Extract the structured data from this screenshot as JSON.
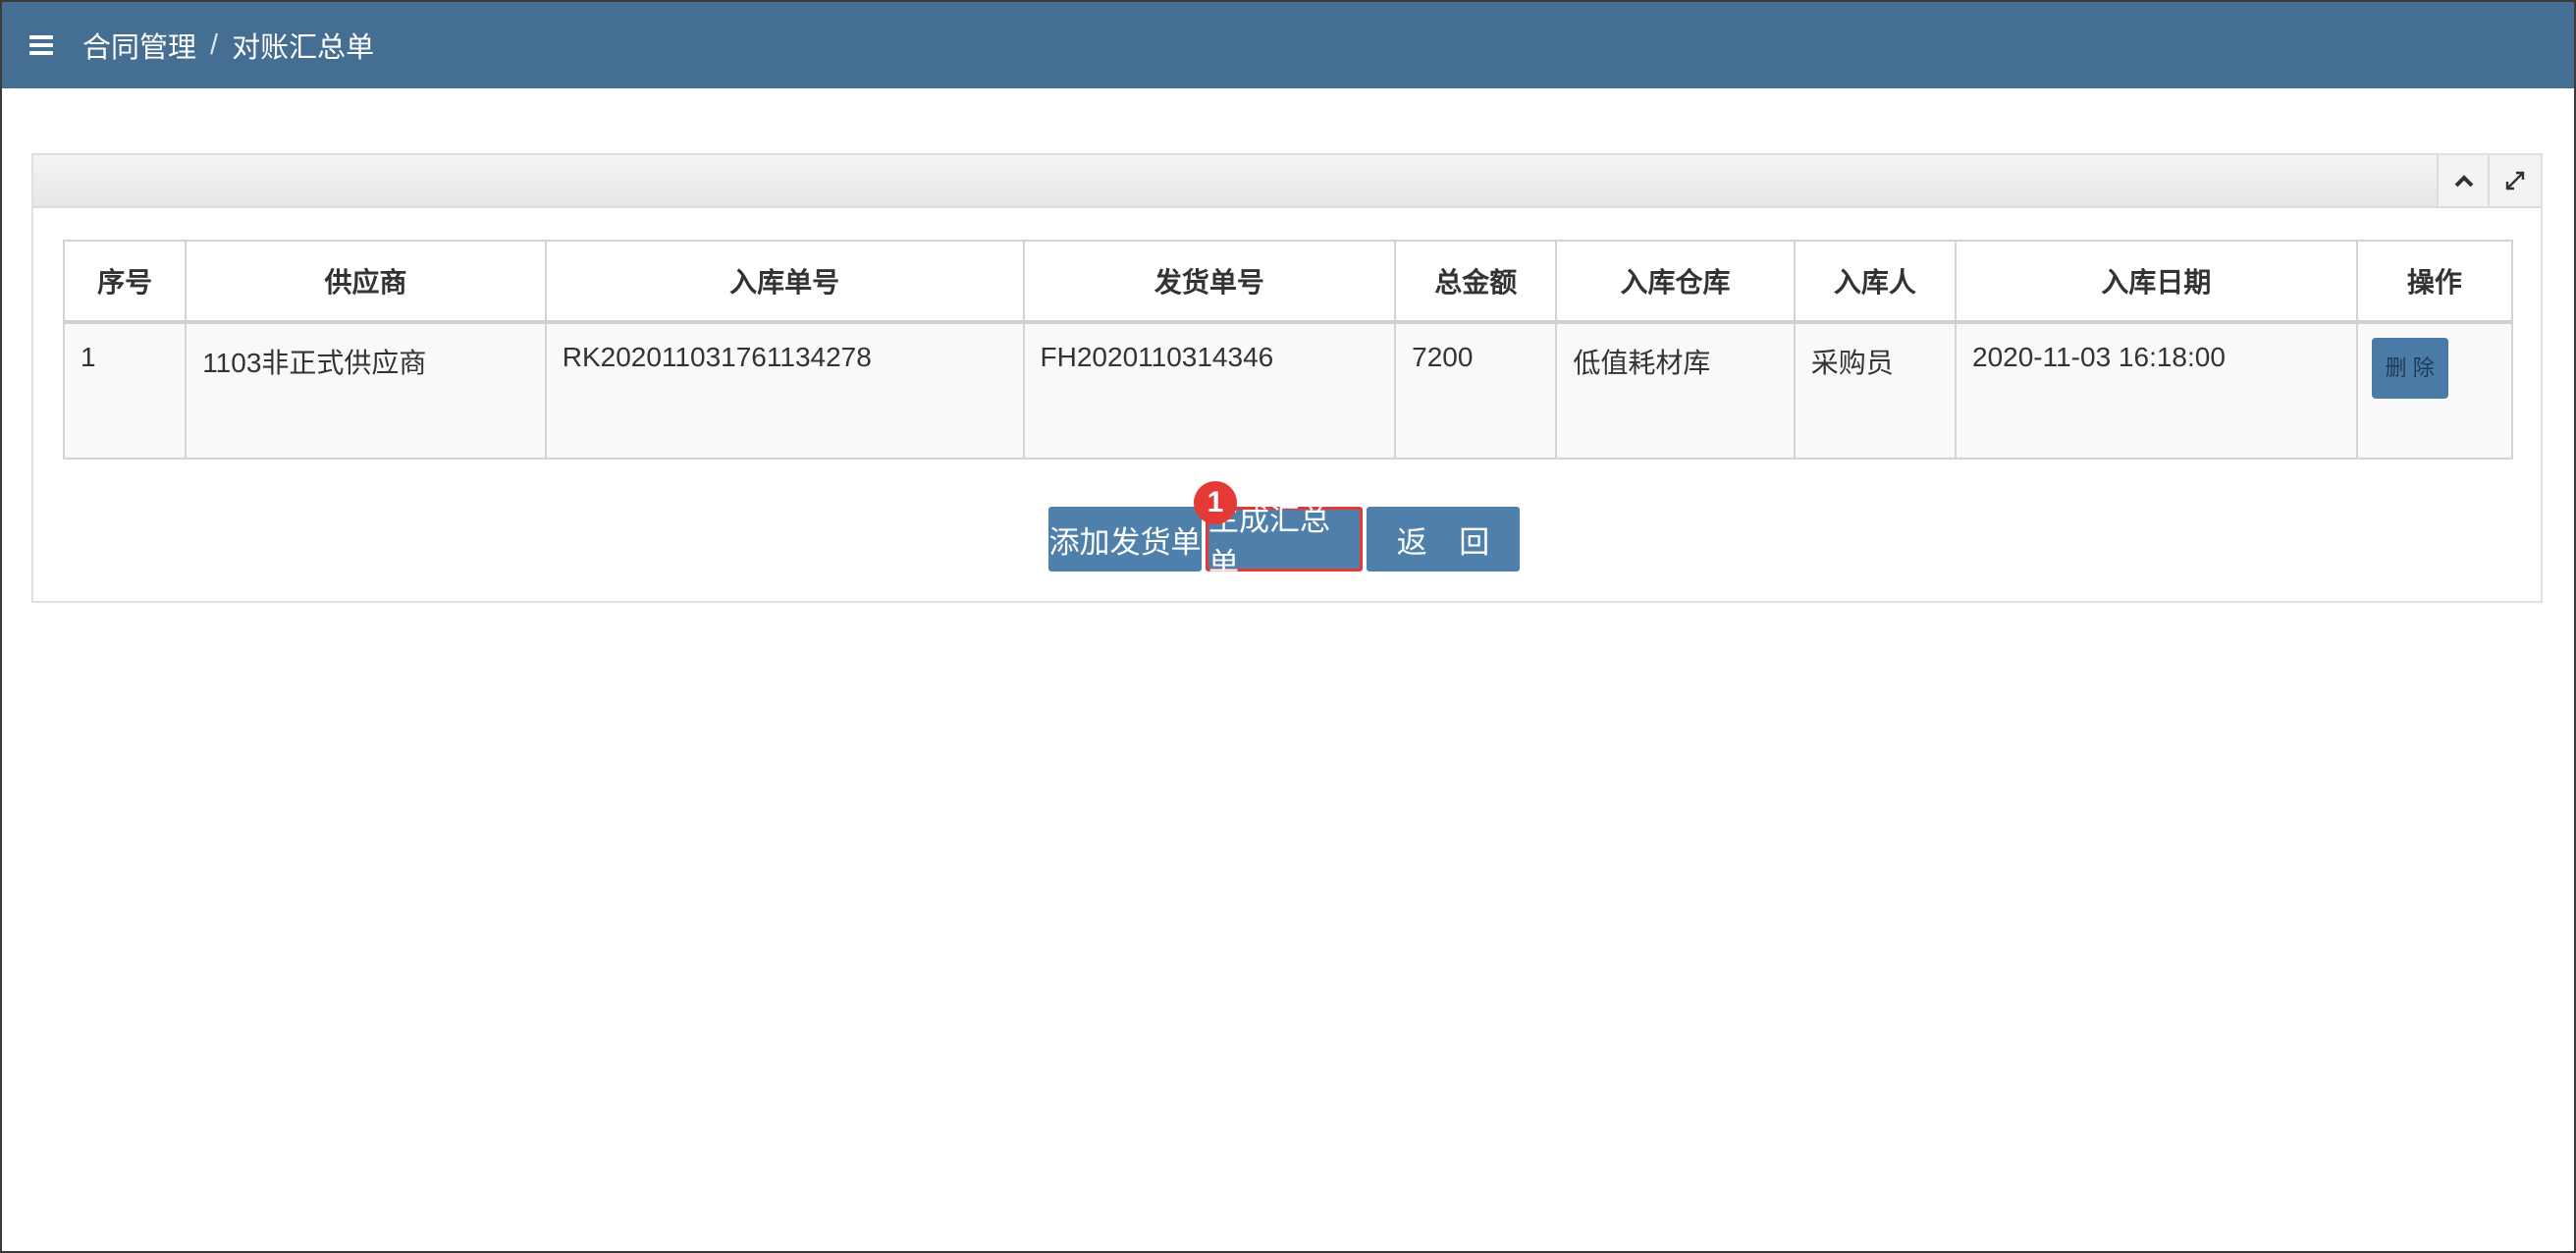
{
  "breadcrumb": {
    "parent": "合同管理",
    "separator": "/",
    "current": "对账汇总单"
  },
  "table": {
    "headers": [
      "序号",
      "供应商",
      "入库单号",
      "发货单号",
      "总金额",
      "入库仓库",
      "入库人",
      "入库日期",
      "操作"
    ],
    "rows": [
      {
        "index": "1",
        "supplier": "1103非正式供应商",
        "receipt_no": "RK202011031761134278",
        "delivery_no": "FH2020110314346",
        "total": "7200",
        "warehouse": "低值耗材库",
        "receiver": "采购员",
        "date": "2020-11-03 16:18:00",
        "action": "删 除"
      }
    ]
  },
  "buttons": {
    "add_delivery": "添加发货单",
    "generate_summary": "生成汇总单",
    "back": "返 回"
  },
  "annotation": {
    "marker": "1"
  },
  "colors": {
    "topbar": "#446e92",
    "button": "#4f80ab",
    "highlight": "#e53935"
  }
}
